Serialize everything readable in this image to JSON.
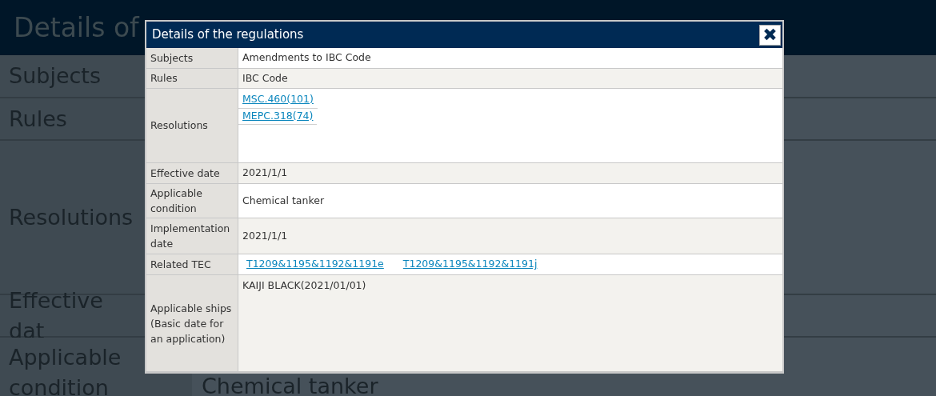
{
  "page": {
    "title": "Details of",
    "rows": [
      {
        "label": "Subjects",
        "value": ""
      },
      {
        "label": "Rules",
        "value": ""
      },
      {
        "label": "Resolutions",
        "value": ""
      },
      {
        "label": "Effective dat",
        "value": ""
      },
      {
        "label": "Applicable condition",
        "value": "Chemical tanker"
      }
    ]
  },
  "dialog": {
    "title": "Details of the regulations",
    "close": "✖",
    "rows": [
      {
        "label": "Subjects",
        "kind": "text",
        "value": "Amendments to IBC Code"
      },
      {
        "label": "Rules",
        "kind": "text",
        "value": "IBC Code"
      },
      {
        "label": "Resolutions",
        "kind": "link_list",
        "links": [
          "MSC.460(101)",
          "MEPC.318(74)"
        ]
      },
      {
        "label": "Effective date",
        "kind": "text",
        "value": "2021/1/1"
      },
      {
        "label": "Applicable condition",
        "kind": "text",
        "value": "Chemical tanker"
      },
      {
        "label": "Implementation date",
        "kind": "text",
        "value": "2021/1/1"
      },
      {
        "label": "Related TEC",
        "kind": "link_row",
        "links": [
          "T1209&1195&1192&1191e",
          "T1209&1195&1192&1191j"
        ]
      },
      {
        "label": "Applicable ships (Basic date for an application)",
        "kind": "top_text",
        "value": "KAIJI BLACK(2021/01/01)"
      }
    ]
  }
}
